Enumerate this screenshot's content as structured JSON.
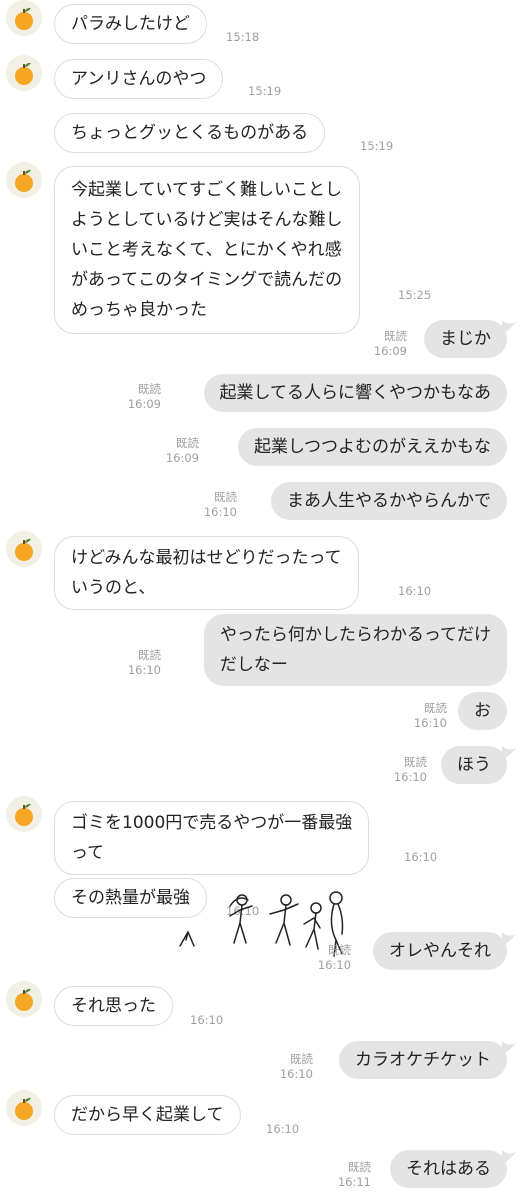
{
  "chat": {
    "read_label": "既読",
    "messages": [
      {
        "text": "パラみしたけど",
        "time": "15:18"
      },
      {
        "text": "アンリさんのやつ",
        "time": "15:19"
      },
      {
        "text": "ちょっとグッとくるものがある",
        "time": "15:19"
      },
      {
        "lines": [
          "今起業していてすごく難しいことし",
          "ようとしているけど実はそんな難し",
          "いこと考えなくて、とにかくやれ感",
          "があってこのタイミングで読んだの",
          "めっちゃ良かった"
        ],
        "time": "15:25"
      },
      {
        "text": "まじか",
        "time": "16:09"
      },
      {
        "text": "起業してる人らに響くやつかもなあ",
        "time": "16:09"
      },
      {
        "text": "起業しつつよむのがええかもな",
        "time": "16:09"
      },
      {
        "text": "まあ人生やるかやらんかで",
        "time": "16:10"
      },
      {
        "lines": [
          "けどみんな最初はせどりだったって",
          "いうのと、"
        ],
        "time": "16:10"
      },
      {
        "lines": [
          "やったら何かしたらわかるってだけ",
          "だしなー"
        ],
        "time": "16:10"
      },
      {
        "text": "お",
        "time": "16:10"
      },
      {
        "text": "ほう",
        "time": "16:10"
      },
      {
        "lines": [
          "ゴミを1000円で売るやつが一番最強",
          "って"
        ],
        "time": "16:10"
      },
      {
        "text": "その熱量が最強",
        "time": "16:10"
      },
      {
        "text": "オレやんそれ",
        "time": "16:10"
      },
      {
        "text": "それ思った",
        "time": "16:10"
      },
      {
        "text": "カラオケチケット",
        "time": "16:10"
      },
      {
        "text": "だから早く起業して",
        "time": "16:10"
      },
      {
        "text": "それはある",
        "time": "16:11"
      }
    ]
  }
}
